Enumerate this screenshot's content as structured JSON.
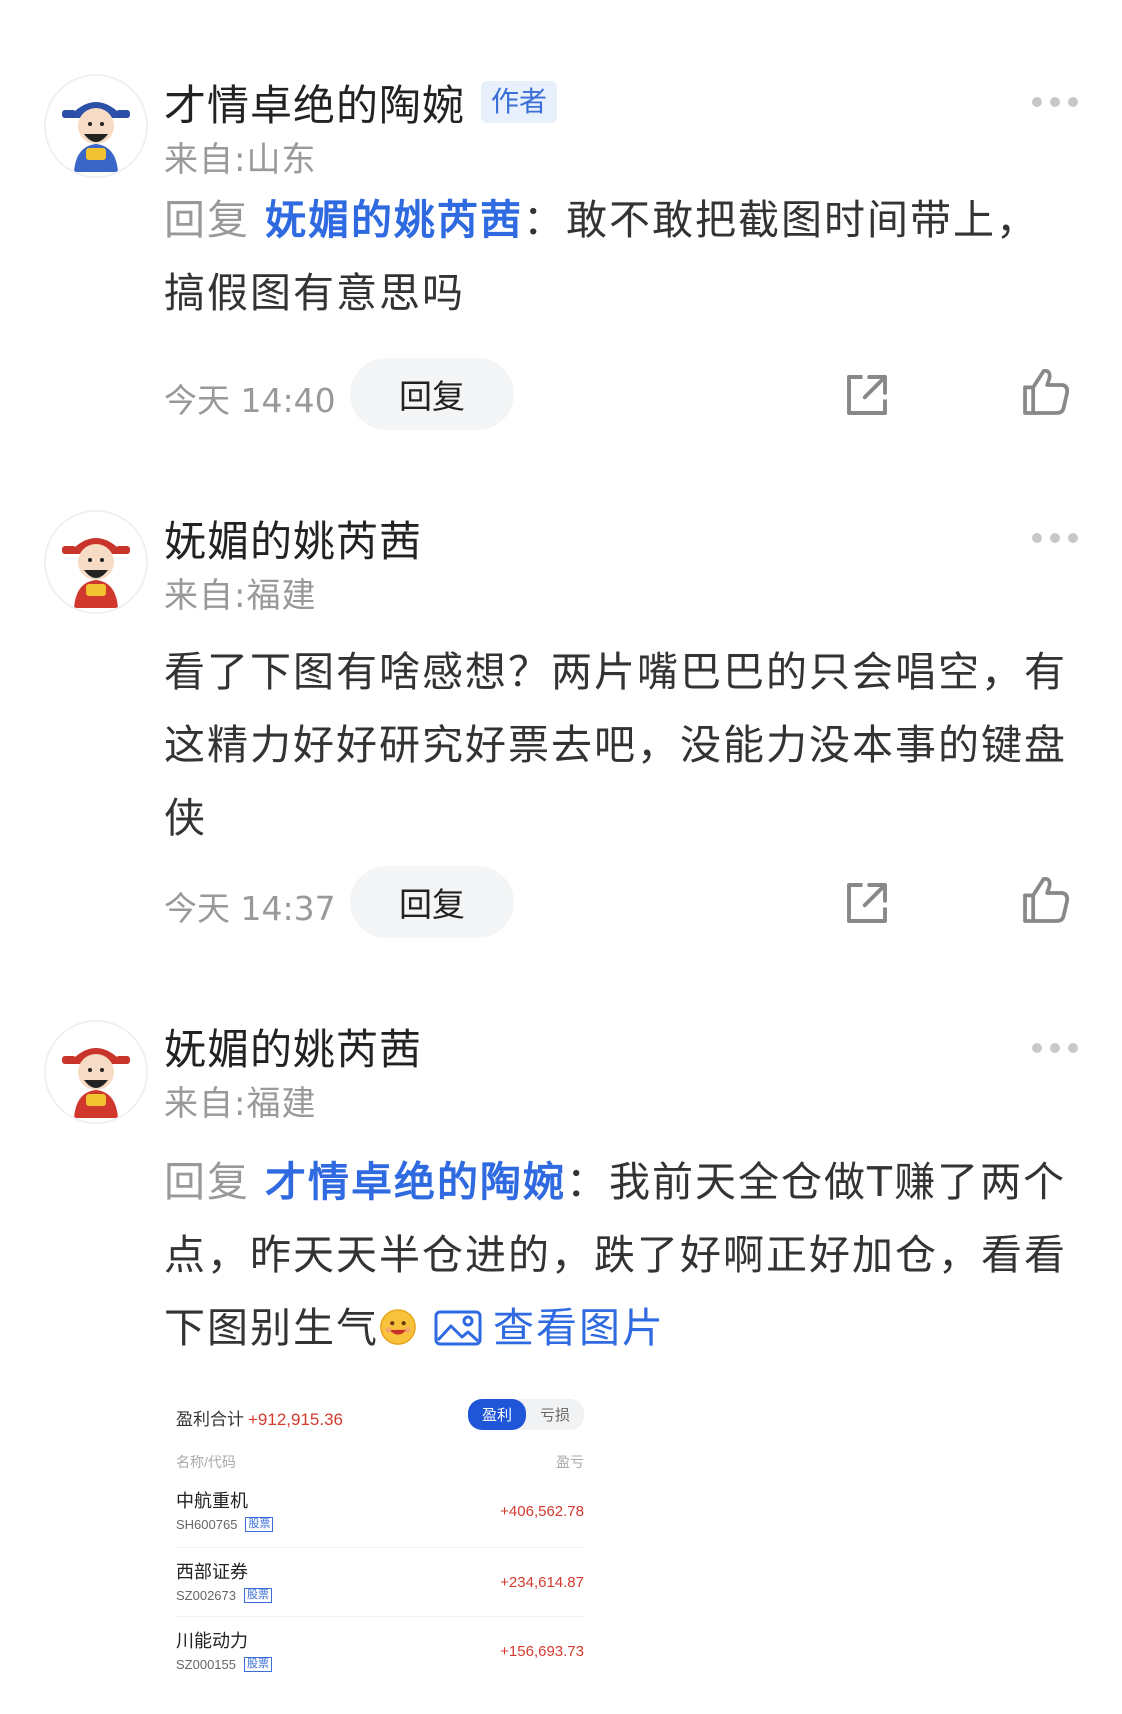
{
  "comments": [
    {
      "name": "才情卓绝的陶婉",
      "badge": "作者",
      "location": "来自:山东",
      "reply_prefix": "回复 ",
      "mention": "妩媚的姚芮茜",
      "text": "：敢不敢把截图时间带上，搞假图有意思吗",
      "time": "今天 14:40",
      "reply_label": "回复",
      "avatar_color": "#3a66c8"
    },
    {
      "name": "妩媚的姚芮茜",
      "location": "来自:福建",
      "text": "看了下图有啥感想？两片嘴巴巴的只会唱空，有这精力好好研究好票去吧，没能力没本事的键盘侠",
      "time": "今天 14:37",
      "reply_label": "回复",
      "avatar_color": "#d0382e"
    },
    {
      "name": "妩媚的姚芮茜",
      "location": "来自:福建",
      "reply_prefix": "回复 ",
      "mention": "才情卓绝的陶婉",
      "text": "：我前天全仓做T赚了两个点，昨天天半仓进的，跌了好啊正好加仓，看看下图别生气",
      "view_image": "查看图片",
      "avatar_color": "#d0382e"
    }
  ],
  "embed": {
    "summary_label": "盈利合计",
    "summary_value": "+912,915.36",
    "tab_profit": "盈利",
    "tab_loss": "亏损",
    "col_name": "名称/代码",
    "col_pnl": "盈亏",
    "rows": [
      {
        "name": "中航重机",
        "code": "SH600765",
        "tag": "股票",
        "pnl": "+406,562.78"
      },
      {
        "name": "西部证券",
        "code": "SZ002673",
        "tag": "股票",
        "pnl": "+234,614.87"
      },
      {
        "name": "川能动力",
        "code": "SZ000155",
        "tag": "股票",
        "pnl": "+156,693.73"
      }
    ]
  },
  "colors": {
    "mention": "#2f6ae0",
    "muted": "#999999",
    "profit": "#d43a2f",
    "tab_active": "#1f56d8"
  },
  "icons": [
    "more-icon",
    "share-icon",
    "thumbs-up-icon",
    "image-icon",
    "smile-emoji"
  ]
}
